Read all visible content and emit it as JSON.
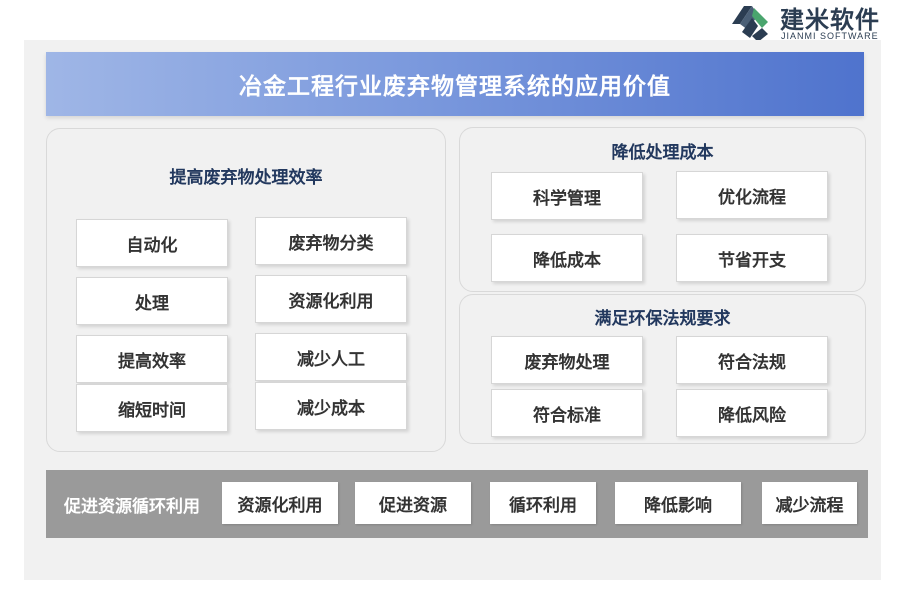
{
  "logo": {
    "cn": "建米软件",
    "en": "JIANMI SOFTWARE"
  },
  "title": "冶金工程行业废弃物管理系统的应用价值",
  "left_panel": {
    "title": "提高废弃物处理效率",
    "items": [
      "自动化",
      "废弃物分类",
      "处理",
      "资源化利用",
      "提高效率",
      "减少人工",
      "缩短时间",
      "减少成本"
    ]
  },
  "right_top_panel": {
    "title": "降低处理成本",
    "items": [
      "科学管理",
      "优化流程",
      "降低成本",
      "节省开支"
    ]
  },
  "right_bottom_panel": {
    "title": "满足环保法规要求",
    "items": [
      "废弃物处理",
      "符合法规",
      "符合标准",
      "降低风险"
    ]
  },
  "bottom_bar": {
    "label": "促进资源循环利用",
    "items": [
      "资源化利用",
      "促进资源",
      "循环利用",
      "降低影响",
      "减少流程"
    ]
  }
}
